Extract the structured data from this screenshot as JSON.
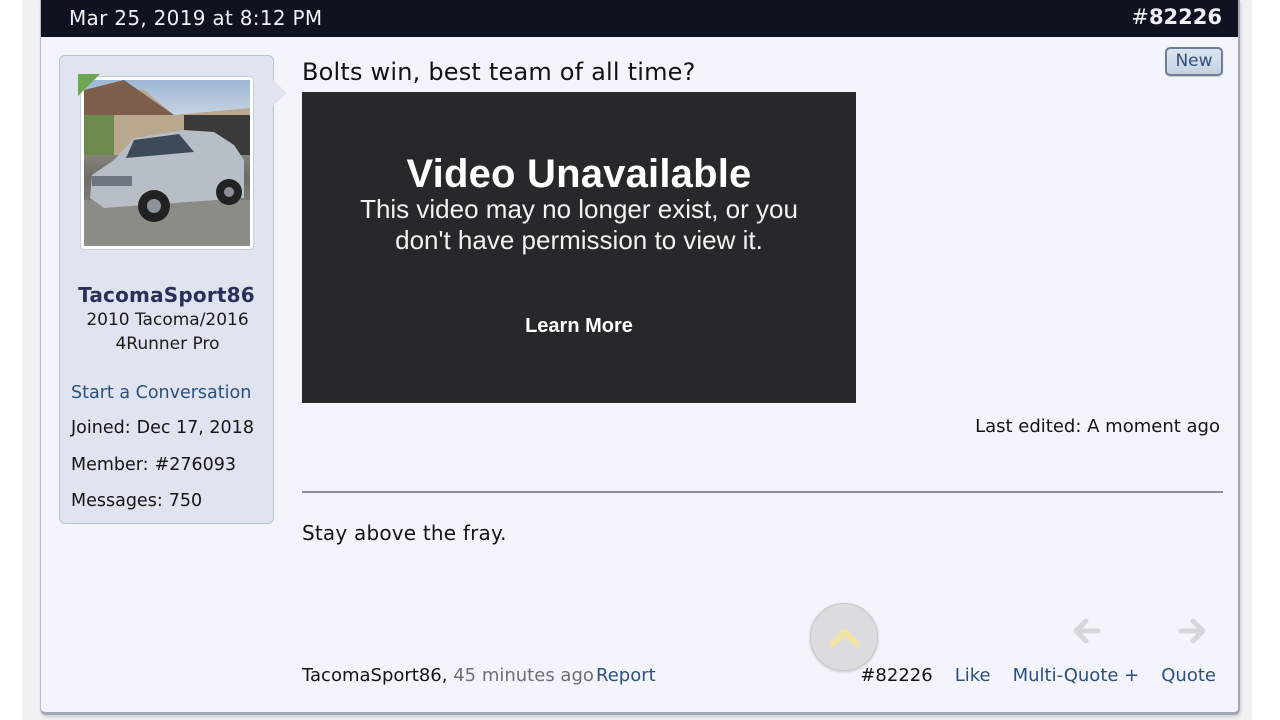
{
  "post": {
    "date": "Mar 25, 2019 at 8:12 PM",
    "number_hash": "#",
    "number": "82226",
    "new_badge": "New",
    "title": "Bolts win, best team of all time?",
    "last_edited": "Last edited: A moment ago",
    "signature": "Stay above the fray."
  },
  "user": {
    "avatar_icon": "truck-photo",
    "username": "TacomaSport86",
    "title": "2010 Tacoma/2016 4Runner Pro",
    "start_conversation": "Start a Conversation",
    "stats": [
      {
        "label": "Joined:",
        "value": "Dec 17, 2018"
      },
      {
        "label": "Member:",
        "value": "#276093"
      },
      {
        "label": "Messages:",
        "value": "750"
      }
    ]
  },
  "video": {
    "title": "Video Unavailable",
    "message": "This video may no longer exist, or you don't have permission to view it.",
    "learn_more": "Learn More"
  },
  "footer": {
    "author": "TacomaSport86,",
    "time": "45 minutes ago",
    "report": "Report",
    "post_number": "#82226",
    "like": "Like",
    "multi_quote": "Multi-Quote +",
    "quote": "Quote"
  },
  "colors": {
    "header_bg": "#0f1321",
    "link": "#2c4f7c",
    "user_card_bg": "#dfe4f0",
    "video_bg": "#28282a"
  }
}
